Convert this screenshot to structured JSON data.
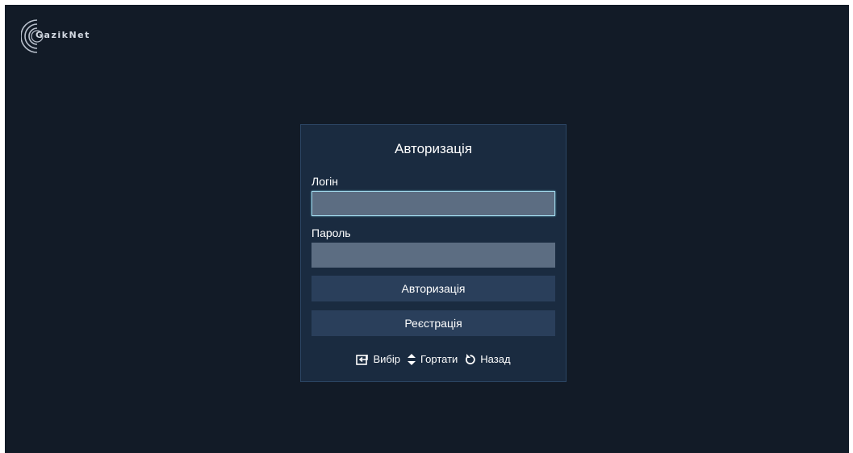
{
  "app": {
    "logo_text": "GazikNet"
  },
  "dialog": {
    "title": "Авторизація",
    "login_label": "Логін",
    "login_value": "",
    "password_label": "Пароль",
    "password_value": "",
    "auth_button": "Авторизація",
    "register_button": "Реєстрація"
  },
  "hints": [
    {
      "icon": "enter-icon",
      "label": "Вибір"
    },
    {
      "icon": "up-down-arrows-icon",
      "label": "Гортати"
    },
    {
      "icon": "back-arrow-icon",
      "label": "Назад"
    }
  ],
  "colors": {
    "background": "#121b27",
    "dialog": "#1a2b40",
    "input": "#5c6d82",
    "button": "#2a3f5b",
    "focus_border": "#9fd6e9"
  }
}
